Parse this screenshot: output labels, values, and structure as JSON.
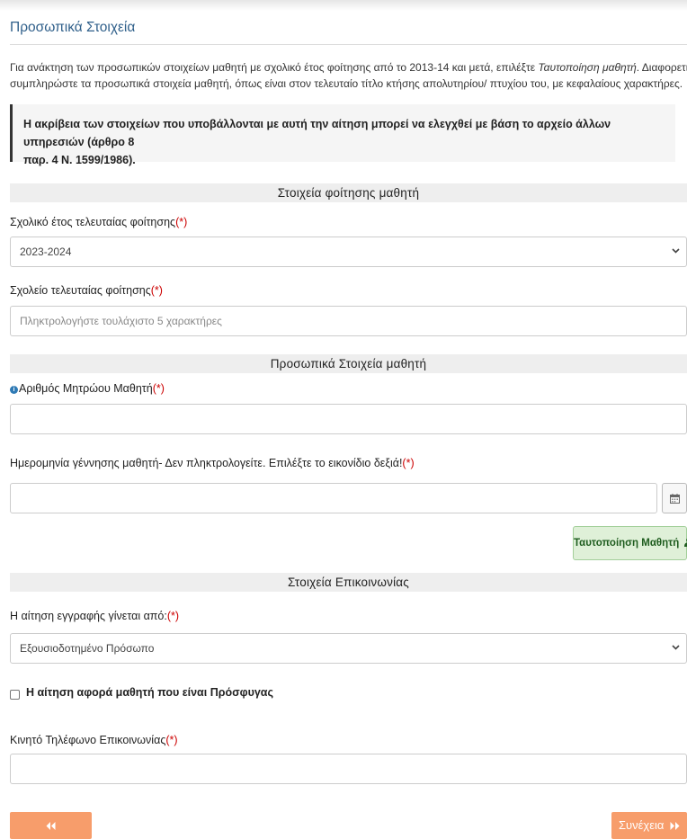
{
  "page_title": "Προσωπικά Στοιχεία",
  "intro": {
    "line1_part1": "Για ανάκτηση των προσωπικών στοιχείων μαθητή με σχολικό έτος φοίτησης από το 2013-14 και μετά, επιλέξτε ",
    "line1_italic": "Ταυτοποίηση μαθητή",
    "line1_part2": ". Διαφορετικά",
    "line2": "συμπληρώστε τα προσωπικά στοιχεία μαθητή, όπως είναι στον τελευταίο τίτλο κτήσης απολυτηρίου/ πτυχίου του, με κεφαλαίους χαρακτήρες."
  },
  "note": {
    "line1": "Η ακρίβεια των στοιχείων που υποβάλλονται με αυτή την αίτηση μπορεί να ελεγχθεί με βάση το αρχείο άλλων υπηρεσιών (άρθρο 8",
    "line2": "παρ. 4 Ν. 1599/1986)."
  },
  "required_mark": "(*)",
  "section_attendance": {
    "title": "Στοιχεία φοίτησης μαθητή",
    "year_label": "Σχολικό έτος τελευταίας φοίτησης",
    "year_value": "2023-2024",
    "school_label": "Σχολείο τελευταίας φοίτησης",
    "school_placeholder": "Πληκτρολογήστε τουλάχιστο 5 χαρακτήρες"
  },
  "section_personal": {
    "title": "Προσωπικά Στοιχεία μαθητή",
    "registry_label": "Αριθμός Μητρώου Μαθητή",
    "registry_value": "",
    "birthdate_label": "Ημερομηνία γέννησης μαθητή- Δεν πληκτρολογείτε. Επιλέξτε το εικονίδιο δεξιά!",
    "birthdate_value": "",
    "verify_button": "Ταυτοποίηση Μαθητή"
  },
  "section_contact": {
    "title": "Στοιχεία Επικοινωνίας",
    "applicant_label": "Η αίτηση εγγραφής γίνεται από:",
    "applicant_value": "Εξουσιοδοτημένο Πρόσωπο",
    "refugee_label": "Η αίτηση αφορά μαθητή που είναι Πρόσφυγας",
    "refugee_checked": false,
    "phone_label": "Κινητό Τηλέφωνο Επικοινωνίας",
    "phone_value": ""
  },
  "nav": {
    "next_label": "Συνέχεια"
  },
  "icons": {
    "info": "info-icon",
    "calendar": "calendar-icon",
    "user": "user-icon",
    "back": "double-chevron-left-icon",
    "next": "double-chevron-right-icon",
    "dropdown": "chevron-down-icon"
  },
  "colors": {
    "title_blue": "#2f5f8a",
    "required_red": "#cc0000",
    "nav_orange": "#f79d6b",
    "verify_green_bg": "#dff0d8",
    "verify_green_text": "#1f5d1f"
  }
}
